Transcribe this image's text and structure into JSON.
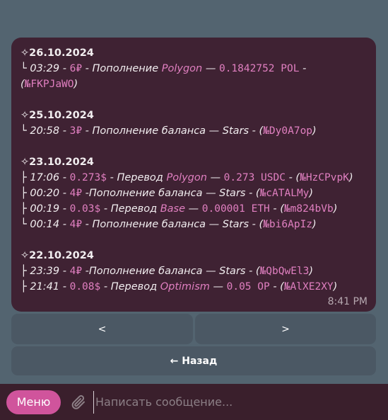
{
  "message": {
    "groups": [
      {
        "date": "✧26.10.2024",
        "lines": [
          {
            "prefix": "└",
            "time": "03:29",
            "amount": "6₽",
            "desc1": "Пополнение",
            "net": "Polygon",
            "sep": "—",
            "value": "0.1842752 POL",
            "code": "№FKPJaWO"
          }
        ]
      },
      {
        "date": "✧25.10.2024",
        "lines": [
          {
            "prefix": "└",
            "time": "20:58",
            "amount": "3₽",
            "desc1": "Пополнение баланса — Stars",
            "code": "№Dy0A7op"
          }
        ]
      },
      {
        "date": "✧23.10.2024",
        "lines": [
          {
            "prefix": "├",
            "time": "17:06",
            "amount": "0.273$",
            "desc1": "Перевод",
            "net": "Polygon",
            "sep": "—",
            "value": "0.273 USDC",
            "code": "№HzCPvpK"
          },
          {
            "prefix": "├",
            "time": "00:20",
            "amount": "4₽",
            "desc1": "Пополнение баланса — Stars",
            "code": "№cATALMy"
          },
          {
            "prefix": "├",
            "time": "00:19",
            "amount": "0.03$",
            "desc1": "Перевод",
            "net": "Base",
            "sep": "—",
            "value": "0.00001 ETH",
            "code": "№m824bVb"
          },
          {
            "prefix": "└",
            "time": "00:14",
            "amount": "4₽",
            "desc1": "Пополнение баланса — Stars",
            "code": "№bi6ApIz"
          }
        ]
      },
      {
        "date": "✧22.10.2024",
        "lines": [
          {
            "prefix": "├",
            "time": "23:39",
            "amount": "4₽",
            "desc1": "Пополнение баланса — Stars",
            "code": "№QbQwEl3"
          },
          {
            "prefix": "├",
            "time": "21:41",
            "amount": "0.08$",
            "desc1": "Перевод",
            "net": "Optimism",
            "sep": "—",
            "value": "0.05 OP",
            "code": "№AlXE2XY"
          }
        ]
      }
    ],
    "timestamp": "8:41 PM"
  },
  "keyboard": {
    "prev": "<",
    "next": ">",
    "back": "← Назад"
  },
  "bottom": {
    "menu": "Меню",
    "placeholder": "Написать сообщение..."
  },
  "colors": {
    "bubble": "#3f2233",
    "accent": "#e07fc0",
    "menu_button": "#d0549c",
    "background": "#536470"
  },
  "icons": {
    "attach": "paperclip-icon"
  }
}
